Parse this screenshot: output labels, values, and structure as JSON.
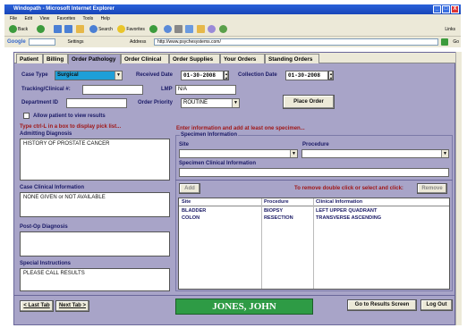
{
  "window": {
    "title": "Windopath - Microsoft Internet Explorer",
    "min": "_",
    "max": "□",
    "close": "X"
  },
  "menu": [
    "File",
    "Edit",
    "View",
    "Favorites",
    "Tools",
    "Help"
  ],
  "toolbar": {
    "back": "Back",
    "search": "Search",
    "favorites": "Favorites",
    "links": "Links"
  },
  "addressbar": {
    "google": "Google",
    "settings": "Settings",
    "label": "Address",
    "url": "http://www.psychesystems.com/",
    "go": "Go"
  },
  "tabs": [
    "Patient",
    "Billing",
    "Order Pathology",
    "Order Clinical",
    "Order Supplies",
    "Your Orders",
    "Standing Orders"
  ],
  "form": {
    "case_type_label": "Case Type",
    "case_type_value": "Surgical",
    "received_date_label": "Received Date",
    "received_date": "01-30-2008",
    "collection_date_label": "Collection Date",
    "collection_date": "01-30-2008",
    "tracking_label": "Tracking/Clinical #:",
    "tracking_value": "",
    "lmp_label": "LMP",
    "lmp_value": "N/A",
    "dept_label": "Department ID",
    "dept_value": "",
    "priority_label": "Order Priority",
    "priority_value": "ROUTINE",
    "place_order": "Place Order",
    "allow_label": "Allow patient to view results",
    "hint": "Type ctrl-L in a box to display pick list...",
    "instruction": "Enter information and add at least one specimen...",
    "admitting_label": "Admitting Diagnosis",
    "admitting_value": "HISTORY OF PROSTATE CANCER",
    "case_clinical_label": "Case Clinical Information",
    "case_clinical_value": "NONE GIVEN or NOT AVAILABLE",
    "postop_label": "Post-Op Diagnosis",
    "postop_value": "",
    "special_label": "Special Instructions",
    "special_value": "PLEASE CALL RESULTS"
  },
  "specimen": {
    "group_label": "Specimen Information",
    "site_label": "Site",
    "procedure_label": "Procedure",
    "clinical_label": "Specimen Clinical Information",
    "add": "Add",
    "remove_hint": "To remove double click or select and click:",
    "remove": "Remove",
    "columns": [
      "Site",
      "Procedure",
      "Clinical Information"
    ],
    "rows": [
      [
        "BLADDER",
        "BIOPSY",
        "LEFT UPPER QUADRANT"
      ],
      [
        "COLON",
        "RESECTION",
        "TRANSVERSE ASCENDING"
      ]
    ]
  },
  "footer": {
    "last_tab": "< Last Tab",
    "next_tab": "Next Tab >",
    "patient": "JONES, JOHN",
    "go_results": "Go to Results Screen",
    "logout": "Log Out"
  },
  "colors": {
    "panel": "#a8a4c8",
    "label": "#1a1a66",
    "alert": "#a01818",
    "case_type": "#1e9fd8",
    "patient_bg": "#2e9b45"
  }
}
